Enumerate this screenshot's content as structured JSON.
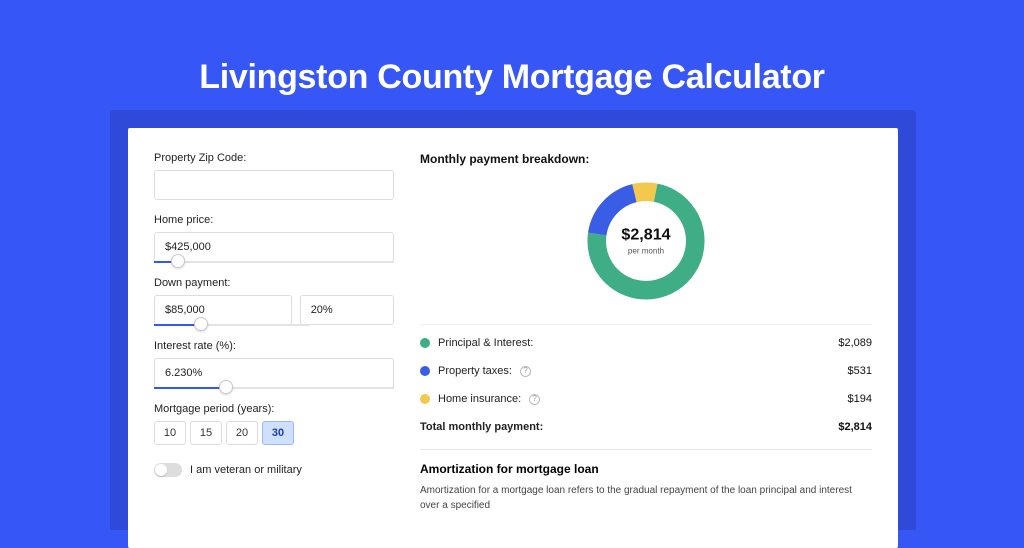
{
  "title": "Livingston County Mortgage Calculator",
  "colors": {
    "accent": "#3656f5",
    "green": "#3fae87",
    "blue": "#3a5de6",
    "yellow": "#f2c94c"
  },
  "form": {
    "zip_label": "Property Zip Code:",
    "zip_value": "",
    "home_price_label": "Home price:",
    "home_price_value": "$425,000",
    "home_price_slider_pct": 10,
    "down_payment_label": "Down payment:",
    "down_payment_value": "$85,000",
    "down_payment_pct_value": "20%",
    "down_payment_slider_pct": 20,
    "interest_label": "Interest rate (%):",
    "interest_value": "6.230%",
    "interest_slider_pct": 30,
    "period_label": "Mortgage period (years):",
    "periods": [
      "10",
      "15",
      "20",
      "30"
    ],
    "period_active_index": 3,
    "veteran_label": "I am veteran or military"
  },
  "breakdown": {
    "title": "Monthly payment breakdown:",
    "center_value": "$2,814",
    "center_sub": "per month",
    "rows": [
      {
        "label": "Principal & Interest:",
        "value": "$2,089",
        "swatch": "green",
        "info": false
      },
      {
        "label": "Property taxes:",
        "value": "$531",
        "swatch": "blue",
        "info": true
      },
      {
        "label": "Home insurance:",
        "value": "$194",
        "swatch": "yellow",
        "info": true
      }
    ],
    "total_label": "Total monthly payment:",
    "total_value": "$2,814"
  },
  "chart_data": {
    "type": "pie",
    "title": "Monthly payment breakdown",
    "categories": [
      "Principal & Interest",
      "Property taxes",
      "Home insurance"
    ],
    "values": [
      2089,
      531,
      194
    ],
    "colors": [
      "#3fae87",
      "#3a5de6",
      "#f2c94c"
    ],
    "total": 2814,
    "center_label": "$2,814 per month"
  },
  "amortization": {
    "title": "Amortization for mortgage loan",
    "text": "Amortization for a mortgage loan refers to the gradual repayment of the loan principal and interest over a specified"
  }
}
